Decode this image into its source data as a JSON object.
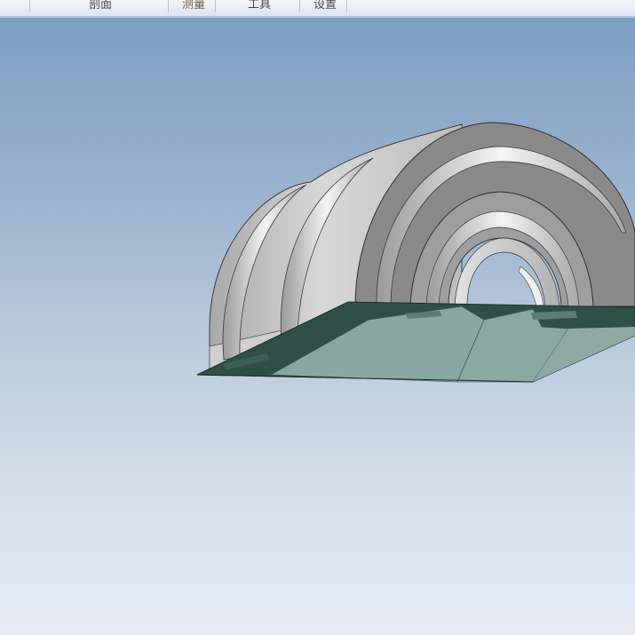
{
  "toolbar": {
    "tabs": [
      {
        "label": "剖面"
      },
      {
        "label": "测量"
      },
      {
        "label": "工具"
      },
      {
        "label": "设置"
      }
    ]
  },
  "viewport": {
    "model_name": "tunnel-arch-model",
    "colors": {
      "background_top": "#7c9ec3",
      "background_bottom": "#e6ecf4",
      "shell": "#c8c8c8",
      "arch_face": "#8a8a8a",
      "slab": "#2f4f46",
      "glass": "#8fb0a8"
    }
  }
}
